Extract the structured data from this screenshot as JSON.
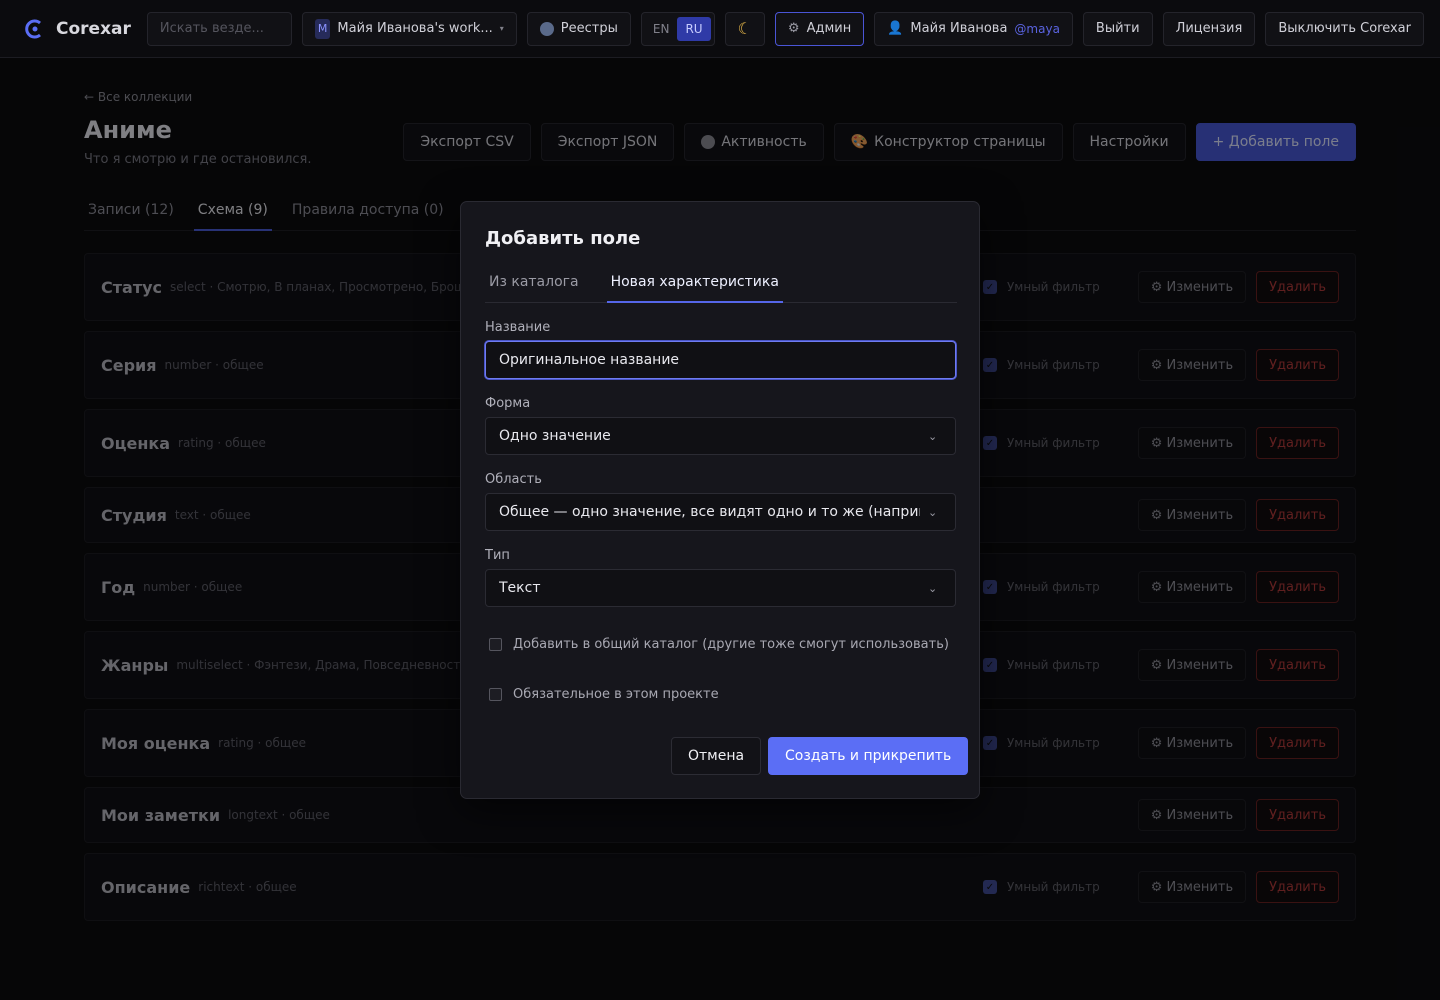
{
  "topbar": {
    "brand": "Corexar",
    "search_placeholder": "Искать везде...",
    "workspace_badge": "M",
    "workspace": "Майя Иванова's work...",
    "registries": "Реестры",
    "lang_en": "EN",
    "lang_ru": "RU",
    "admin": "Админ",
    "user_name": "Майя Иванова",
    "user_handle": "@maya",
    "logout": "Выйти",
    "license": "Лицензия",
    "disable": "Выключить Corexar"
  },
  "page": {
    "back": "← Все коллекции",
    "title": "Аниме",
    "subtitle": "Что я смотрю и где остановился.",
    "actions": {
      "export_csv": "Экспорт CSV",
      "export_json": "Экспорт JSON",
      "activity": "Активность",
      "page_builder": "Конструктор страницы",
      "settings": "Настройки",
      "add_field": "+ Добавить поле"
    },
    "tabs": [
      "Записи (12)",
      "Схема (9)",
      "Правила доступа (0)"
    ]
  },
  "fields": [
    {
      "name": "Статус",
      "meta": "select · Смотрю, В планах, Просмотрено, Брошено",
      "smart": true
    },
    {
      "name": "Серия",
      "meta": "number · общее",
      "smart": true
    },
    {
      "name": "Оценка",
      "meta": "rating · общее",
      "smart": true
    },
    {
      "name": "Студия",
      "meta": "text · общее",
      "smart": false
    },
    {
      "name": "Год",
      "meta": "number · общее",
      "smart": true
    },
    {
      "name": "Жанры",
      "meta": "multiselect · Фэнтези, Драма, Повседневность, Детектив",
      "smart": true
    },
    {
      "name": "Моя оценка",
      "meta": "rating · общее",
      "smart": true
    },
    {
      "name": "Мои заметки",
      "meta": "longtext · общее",
      "smart": false
    },
    {
      "name": "Описание",
      "meta": "richtext · общее",
      "smart": true
    }
  ],
  "row_labels": {
    "smart_filter": "Умный фильтр",
    "edit": "⚙ Изменить",
    "delete": "Удалить"
  },
  "modal": {
    "title": "Добавить поле",
    "tabs": [
      "Из каталога",
      "Новая характеристика"
    ],
    "name_label": "Название",
    "name_value": "Оригинальное название",
    "form_label": "Форма",
    "form_value": "Одно значение",
    "scope_label": "Область",
    "scope_value": "Общее — одно значение, все видят одно и то же (например, о",
    "type_label": "Тип",
    "type_value": "Текст",
    "catalog_check": "Добавить в общий каталог (другие тоже смогут использовать)",
    "required_check": "Обязательное в этом проекте",
    "cancel": "Отмена",
    "create": "Создать и прикрепить"
  }
}
